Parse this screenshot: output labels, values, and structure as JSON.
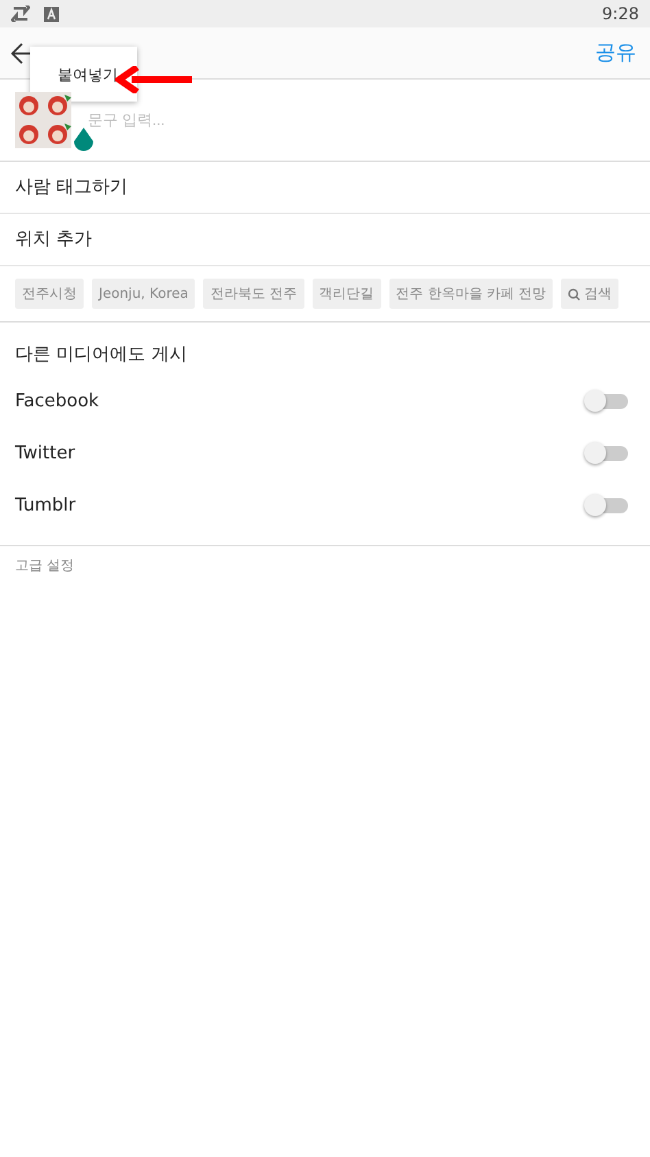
{
  "status_bar": {
    "time": "9:28"
  },
  "header": {
    "action": "공유"
  },
  "popup_menu": {
    "items": [
      "붙여넣기"
    ]
  },
  "caption": {
    "placeholder": "문구 입력..."
  },
  "rows": [
    "사람 태그하기",
    "위치 추가"
  ],
  "location_chips": [
    {
      "label": "전주시청",
      "kind": "text"
    },
    {
      "label": "Jeonju, Korea",
      "kind": "text"
    },
    {
      "label": "전라북도 전주",
      "kind": "text"
    },
    {
      "label": "객리단길",
      "kind": "text"
    },
    {
      "label": "전주 한옥마을 카페 전망",
      "kind": "text"
    },
    {
      "label": "검색",
      "kind": "search"
    }
  ],
  "share_section": {
    "heading": "다른 미디어에도 게시",
    "services": [
      {
        "name": "Facebook",
        "on": false
      },
      {
        "name": "Twitter",
        "on": false
      },
      {
        "name": "Tumblr",
        "on": false
      }
    ]
  },
  "advanced": "고급 설정"
}
